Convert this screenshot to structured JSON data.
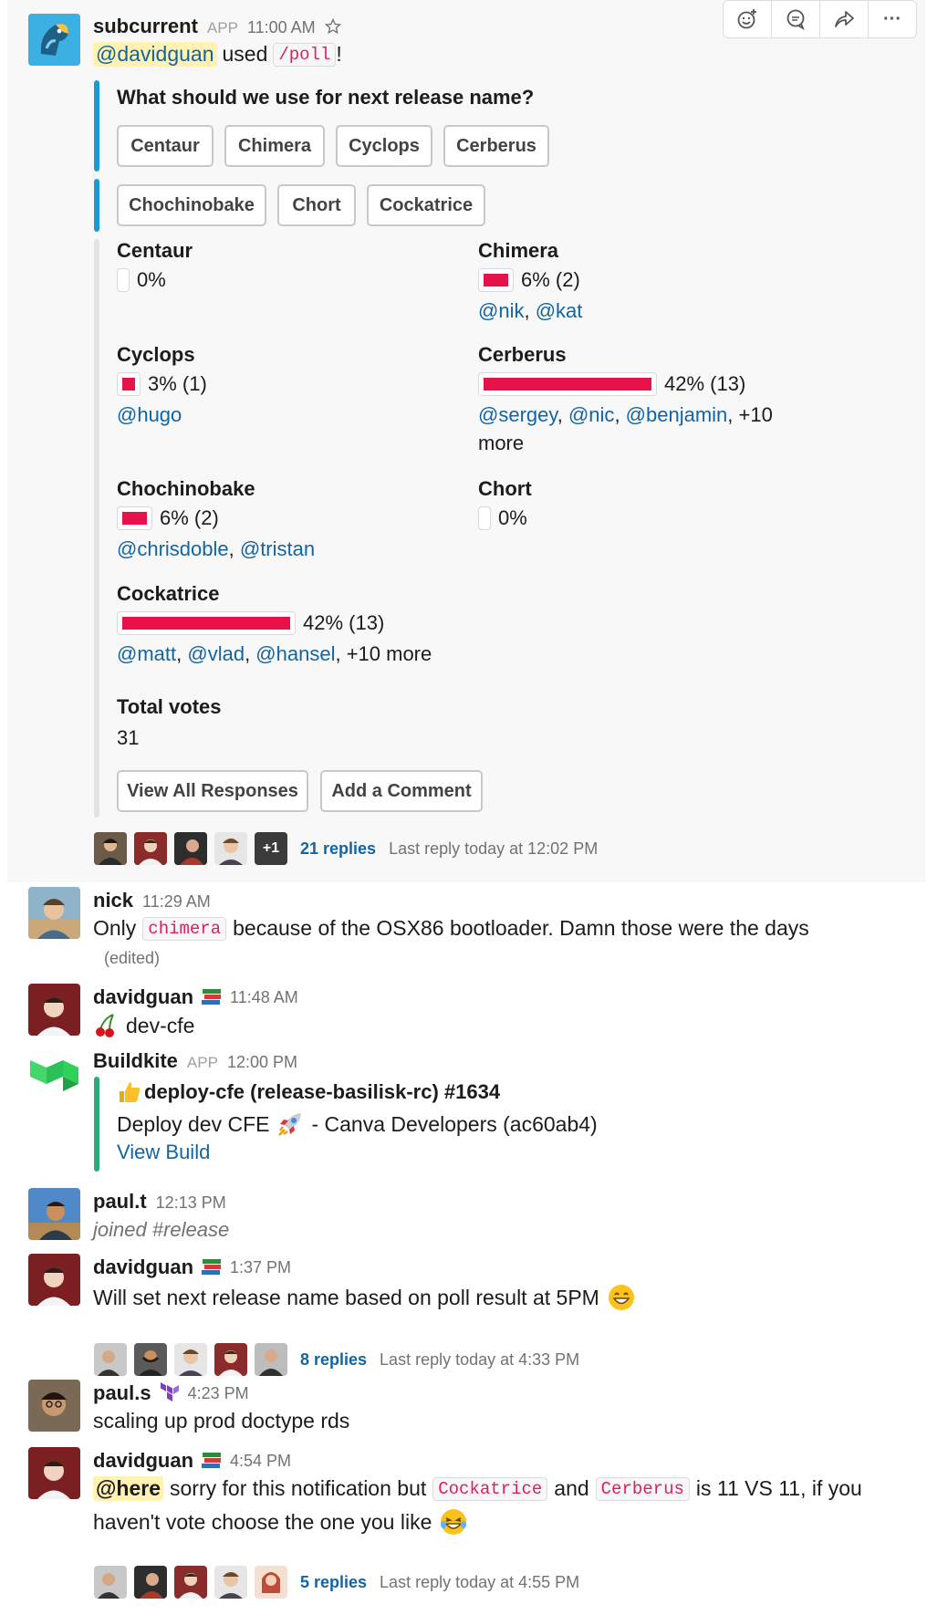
{
  "toolbar": {
    "icons": [
      "add-reaction-icon",
      "comment-icon",
      "share-icon",
      "more-actions-icon"
    ],
    "more_label": "···"
  },
  "messages": [
    {
      "author": "subcurrent",
      "app_tag": "APP",
      "time": "11:00 AM",
      "mention": "@davidguan",
      "used": "used",
      "command": "/poll",
      "bang": "!",
      "poll": {
        "question": "What should we use for next release name?",
        "options_row1": [
          "Centaur",
          "Chimera",
          "Cyclops",
          "Cerberus"
        ],
        "options_row2": [
          "Chochinobake",
          "Chort",
          "Cockatrice"
        ],
        "results": [
          {
            "name": "Centaur",
            "pct_text": "0%",
            "fraction": 0.0,
            "voters": []
          },
          {
            "name": "Chimera",
            "pct_text": "6% (2)",
            "fraction": 0.06,
            "voters": [
              "@nik",
              "@kat"
            ]
          },
          {
            "name": "Cyclops",
            "pct_text": "3% (1)",
            "fraction": 0.03,
            "voters": [
              "@hugo"
            ]
          },
          {
            "name": "Cerberus",
            "pct_text": "42% (13)",
            "fraction": 0.42,
            "voters": [
              "@sergey",
              "@nic",
              "@benjamin"
            ],
            "more": ", +10 more"
          },
          {
            "name": "Chochinobake",
            "pct_text": "6% (2)",
            "fraction": 0.06,
            "voters": [
              "@chrisdoble",
              "@tristan"
            ]
          },
          {
            "name": "Chort",
            "pct_text": "0%",
            "fraction": 0.0,
            "voters": []
          },
          {
            "name": "Cockatrice",
            "pct_text": "42% (13)",
            "fraction": 0.42,
            "voters": [
              "@matt",
              "@vlad",
              "@hansel"
            ],
            "more": ", +10 more"
          }
        ],
        "total_label": "Total votes",
        "total_value": "31",
        "view_all_label": "View All Responses",
        "add_comment_label": "Add a Comment"
      },
      "thread": {
        "extra_count": "+1",
        "replies": "21 replies",
        "last_reply": "Last reply today at 12:02 PM"
      }
    },
    {
      "author": "nick",
      "time": "11:29 AM",
      "text_before": "Only",
      "code": "chimera",
      "text_after": "because of the OSX86 bootloader. Damn those were the days",
      "edited": "(edited)"
    },
    {
      "author": "davidguan",
      "status_icon": "books-emoji-icon",
      "time": "11:48 AM",
      "emoji": "cherries-emoji-icon",
      "text": "dev-cfe"
    },
    {
      "author": "Buildkite",
      "app_tag": "APP",
      "time": "12:00 PM",
      "attachment": {
        "emoji": "thumbs-up-emoji-icon",
        "title": "deploy-cfe (release-basilisk-rc) #1634",
        "line2_before": "Deploy dev CFE",
        "line2_emoji": "rocket-emoji-icon",
        "line2_after": "- Canva Developers (ac60ab4)",
        "link": "View Build"
      }
    },
    {
      "author": "paul.t",
      "time": "12:13 PM",
      "text": "joined #release"
    },
    {
      "author": "davidguan",
      "status_icon": "books-emoji-icon",
      "time": "1:37 PM",
      "text": "Will set next release name based on poll result at 5PM",
      "emoji": "grinning-emoji-icon",
      "thread": {
        "replies": "8 replies",
        "last_reply": "Last reply today at 4:33 PM"
      }
    },
    {
      "author": "paul.s",
      "status_icon": "terraform-icon",
      "time": "4:23 PM",
      "text": "scaling up prod doctype rds"
    },
    {
      "author": "davidguan",
      "status_icon": "books-emoji-icon",
      "time": "4:54 PM",
      "here": "@here",
      "text_a": "sorry for this notification but",
      "code_a": "Cockatrice",
      "text_b": "and",
      "code_b": "Cerberus",
      "text_c": "is 11 VS 11, if you",
      "text_line2": "haven't vote choose the one you like",
      "emoji": "laughing-emoji-icon",
      "thread": {
        "replies": "5 replies",
        "last_reply": "Last reply today at 4:55 PM"
      }
    }
  ],
  "colors": {
    "poll_bar": "#1d9bd1",
    "result_bar": "#e8114a",
    "buildkite_bar": "#2bac76",
    "link": "#1264a3",
    "code_text": "#e01e5a"
  }
}
